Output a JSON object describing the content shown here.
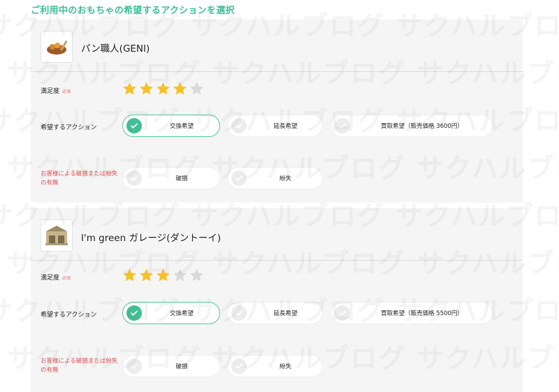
{
  "section_title": "ご利用中のおもちゃの希望するアクションを選択",
  "watermark_text": "サクハルブログ サクハルブログ サクハルブログ サクハルブログ サクハルブログ",
  "labels": {
    "satisfaction": "満足度",
    "required": "必須",
    "action": "希望するアクション",
    "damage_line1": "お客様による破損または紛失",
    "damage_line2": "の有無"
  },
  "colors": {
    "accent": "#3bbf94",
    "star_filled": "#f5c12b",
    "star_empty": "#d9d9d9",
    "required_red": "#e05050"
  },
  "products": [
    {
      "name": "パン職人(GENI)",
      "image_icon": "bread-toy-icon",
      "rating": 4,
      "rating_max": 5,
      "actions": [
        {
          "label": "交換希望",
          "selected": true
        },
        {
          "label": "延長希望",
          "selected": false
        },
        {
          "label": "買取希望（販売価格 3600円）",
          "selected": false
        }
      ],
      "damage_options": [
        {
          "label": "破損",
          "selected": false
        },
        {
          "label": "紛失",
          "selected": false
        }
      ]
    },
    {
      "name": "I'm green ガレージ(ダントーイ)",
      "image_icon": "garage-toy-icon",
      "rating": 3,
      "rating_max": 5,
      "actions": [
        {
          "label": "交換希望",
          "selected": true
        },
        {
          "label": "延長希望",
          "selected": false
        },
        {
          "label": "買取希望（販売価格 5500円）",
          "selected": false
        }
      ],
      "damage_options": [
        {
          "label": "破損",
          "selected": false
        },
        {
          "label": "紛失",
          "selected": false
        }
      ]
    }
  ]
}
